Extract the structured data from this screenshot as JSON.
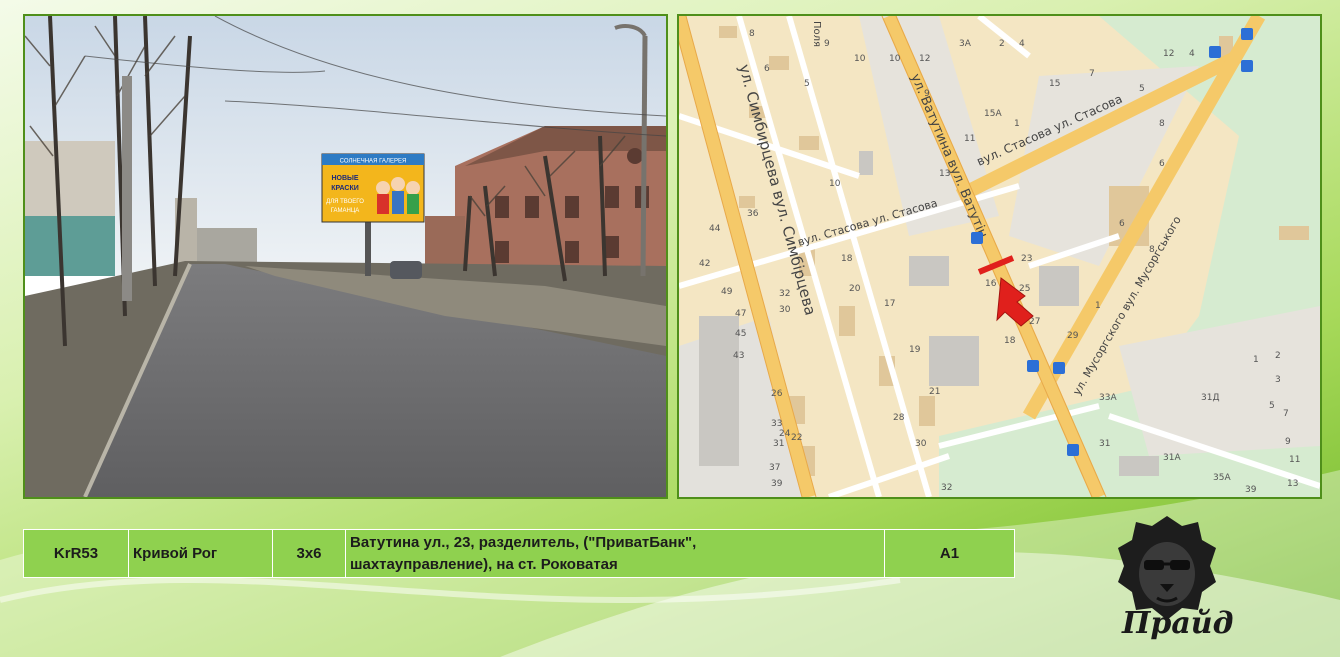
{
  "photo": {
    "billboard_line1": "СОЛНЕЧНАЯ ГАЛЕРЕЯ",
    "billboard_line2": "НОВЫЕ",
    "billboard_line3": "КРАСКИ",
    "billboard_line4": "ДЛЯ ТВОЕГО",
    "billboard_line5": "ГАМАНЦА"
  },
  "map": {
    "street_vatutina": "ул. Ватутина вул. Ватутін",
    "street_stasova_upper": "вул. Стасова ул. Стасова",
    "street_stasova_lower": "вул. Стасова ул. Стасова",
    "street_simbirtseva": "ул. Симбирцева вул. Симбірцева",
    "street_musorgskogo": "ул. Мусоргского вул. Мусоргського",
    "street_polya": "Поля",
    "house_numbers": [
      {
        "t": "8"
      },
      {
        "t": "6"
      },
      {
        "t": "5"
      },
      {
        "t": "9"
      },
      {
        "t": "3А"
      },
      {
        "t": "2"
      },
      {
        "t": "4"
      },
      {
        "t": "10"
      },
      {
        "t": "10"
      },
      {
        "t": "12"
      },
      {
        "t": "15"
      },
      {
        "t": "7"
      },
      {
        "t": "5"
      },
      {
        "t": "9"
      },
      {
        "t": "15А"
      },
      {
        "t": "1"
      },
      {
        "t": "11"
      },
      {
        "t": "8"
      },
      {
        "t": "13"
      },
      {
        "t": "6"
      },
      {
        "t": "36"
      },
      {
        "t": "44"
      },
      {
        "t": "42"
      },
      {
        "t": "18"
      },
      {
        "t": "23"
      },
      {
        "t": "25"
      },
      {
        "t": "16"
      },
      {
        "t": "27"
      },
      {
        "t": "18"
      },
      {
        "t": "29"
      },
      {
        "t": "1"
      },
      {
        "t": "49"
      },
      {
        "t": "47"
      },
      {
        "t": "45"
      },
      {
        "t": "43"
      },
      {
        "t": "32"
      },
      {
        "t": "30"
      },
      {
        "t": "26"
      },
      {
        "t": "24"
      },
      {
        "t": "22"
      },
      {
        "t": "20"
      },
      {
        "t": "17"
      },
      {
        "t": "19"
      },
      {
        "t": "21"
      },
      {
        "t": "28"
      },
      {
        "t": "30"
      },
      {
        "t": "31"
      },
      {
        "t": "33"
      },
      {
        "t": "37"
      },
      {
        "t": "39"
      },
      {
        "t": "33А"
      },
      {
        "t": "31Д"
      },
      {
        "t": "31"
      },
      {
        "t": "31А"
      },
      {
        "t": "35А"
      },
      {
        "t": "39"
      },
      {
        "t": "32"
      },
      {
        "t": "21А"
      },
      {
        "t": "24"
      },
      {
        "t": "1"
      },
      {
        "t": "2"
      },
      {
        "t": "3"
      },
      {
        "t": "5"
      },
      {
        "t": "7"
      },
      {
        "t": "9"
      },
      {
        "t": "11"
      },
      {
        "t": "13"
      },
      {
        "t": "12"
      },
      {
        "t": "4"
      },
      {
        "t": "6"
      },
      {
        "t": "8"
      },
      {
        "t": "10"
      }
    ]
  },
  "info": {
    "code": "KrR53",
    "city": "Кривой Рог",
    "size": "3х6",
    "address_line1": "Ватутина ул., 23, разделитель, (\"ПриватБанк\",",
    "address_line2": "шахтауправление), на ст. Роковатая",
    "side": "А1"
  },
  "logo": {
    "text": "Прайд"
  },
  "colors": {
    "accent": "#8fd14f",
    "frame": "#4f8f1a",
    "road_major": "#f5c969",
    "marker": "#e0201c"
  }
}
